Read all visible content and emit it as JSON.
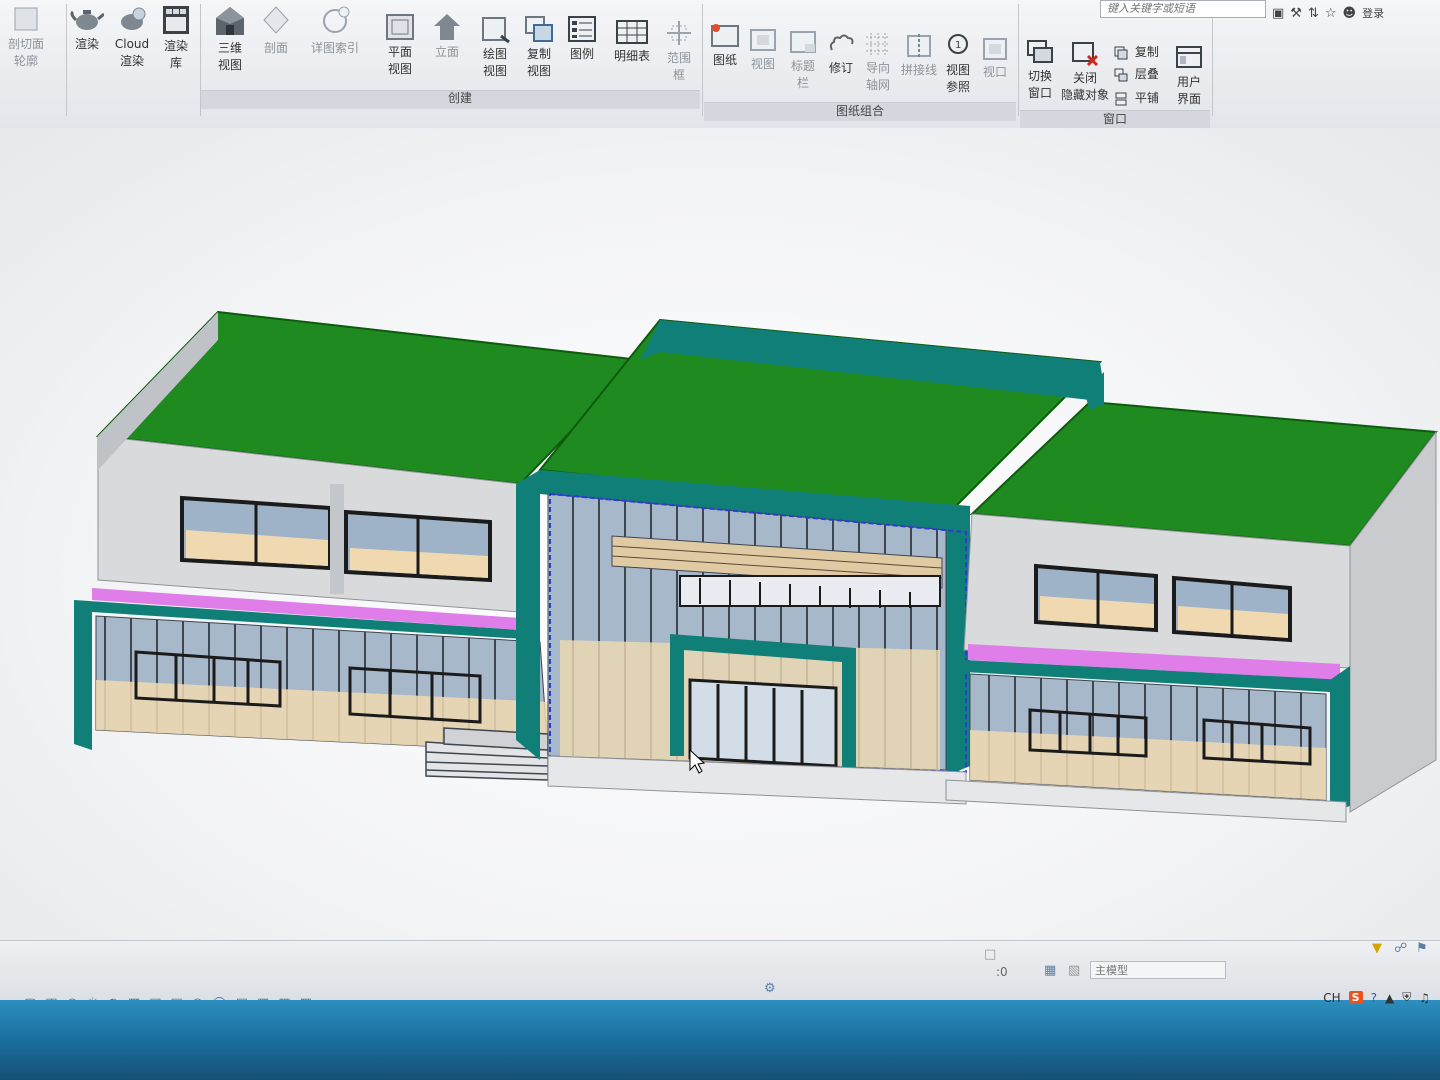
{
  "colors": {
    "roof": "#1f8a1f",
    "fascia": "#0f7f78",
    "wall": "#d9dadc",
    "glass": "#9fb3c8",
    "floor": "#f0d9b0",
    "band": "#e07ee9",
    "selection": "#2a3cd6"
  },
  "ribbon": {
    "panel_create": "创建",
    "panel_sheets": "图纸组合",
    "panel_window": "窗口",
    "buttons": [
      {
        "id": "section-box",
        "label": "剖切面\n轮廓",
        "icon": "section-box-icon"
      },
      {
        "id": "render",
        "label": "渲染",
        "icon": "teapot-icon"
      },
      {
        "id": "cloud-render",
        "label": "Cloud\n渲染",
        "icon": "cloud-teapot-icon"
      },
      {
        "id": "render-gallery",
        "label": "渲染\n库",
        "icon": "gallery-icon"
      },
      {
        "id": "3d-view",
        "label": "三维\n视图",
        "icon": "house-icon"
      },
      {
        "id": "section",
        "label": "剖面",
        "icon": "section-icon"
      },
      {
        "id": "callout",
        "label": "详图索引",
        "icon": "callout-icon"
      },
      {
        "id": "plan-view",
        "label": "平面\n视图",
        "icon": "plan-icon"
      },
      {
        "id": "elevation",
        "label": "立面",
        "icon": "elevation-icon"
      },
      {
        "id": "drafting-view",
        "label": "绘图\n视图",
        "icon": "drafting-icon"
      },
      {
        "id": "duplicate-view",
        "label": "复制\n视图",
        "icon": "duplicate-icon"
      },
      {
        "id": "legend",
        "label": "图例",
        "icon": "legend-icon"
      },
      {
        "id": "schedule",
        "label": "明细表",
        "icon": "schedule-icon"
      },
      {
        "id": "scope-box",
        "label": "范围\n框",
        "icon": "scope-box-icon"
      },
      {
        "id": "sheet",
        "label": "图纸",
        "icon": "sheet-icon"
      },
      {
        "id": "view",
        "label": "视图",
        "icon": "view-icon"
      },
      {
        "id": "title-block",
        "label": "标题\n栏",
        "icon": "title-block-icon"
      },
      {
        "id": "revision",
        "label": "修订",
        "icon": "revision-icon"
      },
      {
        "id": "guide-grid",
        "label": "导向\n轴网",
        "icon": "guide-grid-icon"
      },
      {
        "id": "matchline",
        "label": "拼接线",
        "icon": "matchline-icon"
      },
      {
        "id": "view-reference",
        "label": "视图\n参照",
        "icon": "view-reference-icon"
      },
      {
        "id": "viewport",
        "label": "视口",
        "icon": "viewport-icon"
      },
      {
        "id": "switch-windows",
        "label": "切换\n窗口",
        "icon": "switch-windows-icon"
      },
      {
        "id": "close-hidden",
        "label": "关闭\n隐藏对象",
        "icon": "close-hidden-icon"
      },
      {
        "id": "user-interface",
        "label": "用户\n界面",
        "icon": "user-interface-icon"
      }
    ],
    "small_buttons": [
      {
        "id": "replicate",
        "label": "复制",
        "icon": "replicate-icon"
      },
      {
        "id": "cascade",
        "label": "层叠",
        "icon": "cascade-icon"
      },
      {
        "id": "tile",
        "label": "平铺",
        "icon": "tile-icon"
      }
    ]
  },
  "titlebar": {
    "search_placeholder": "键入关键字或短语",
    "login_label": "登录"
  },
  "status": {
    "scale_value": ":0",
    "model_label": "主模型",
    "tray_text": "CH"
  }
}
